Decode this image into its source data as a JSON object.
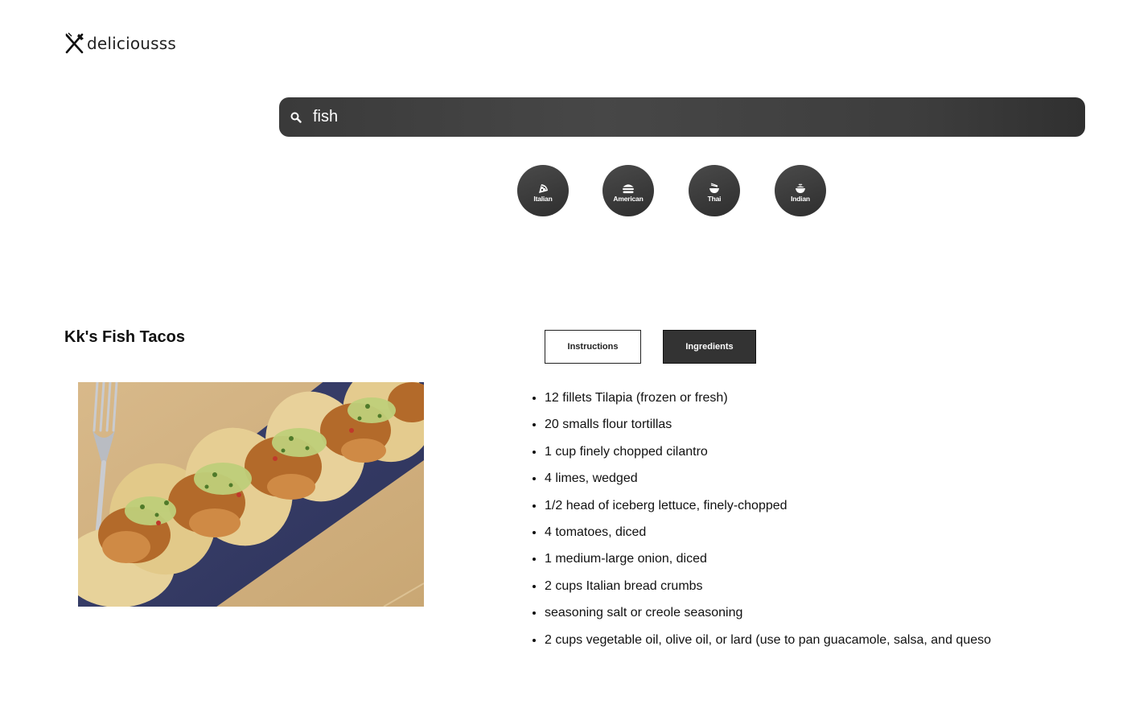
{
  "brand": {
    "name": "deliciousss",
    "icon": "fork-knife-icon"
  },
  "search": {
    "value": "fish",
    "icon": "search-icon"
  },
  "categories": [
    {
      "label": "Italian",
      "icon": "pizza-icon"
    },
    {
      "label": "American",
      "icon": "burger-icon"
    },
    {
      "label": "Thai",
      "icon": "noodle-bowl-icon"
    },
    {
      "label": "Indian",
      "icon": "curry-bowl-icon"
    }
  ],
  "recipe": {
    "title": "Kk's Fish Tacos",
    "tabs": {
      "instructions": "Instructions",
      "ingredients": "Ingredients"
    },
    "active_tab": "Ingredients",
    "ingredients": [
      "12 fillets Tilapia (frozen or fresh)",
      "20 smalls flour tortillas",
      "1 cup finely chopped cilantro",
      "4 limes, wedged",
      "1/2 head of iceberg lettuce, finely-chopped",
      "4 tomatoes, diced",
      "1 medium-large onion, diced",
      "2 cups Italian bread crumbs",
      "seasoning salt or creole seasoning",
      "2 cups vegetable oil, olive oil, or lard (use to pan guacamole, salsa, and queso"
    ]
  },
  "colors": {
    "dark": "#333333",
    "text": "#111111",
    "background": "#ffffff"
  }
}
